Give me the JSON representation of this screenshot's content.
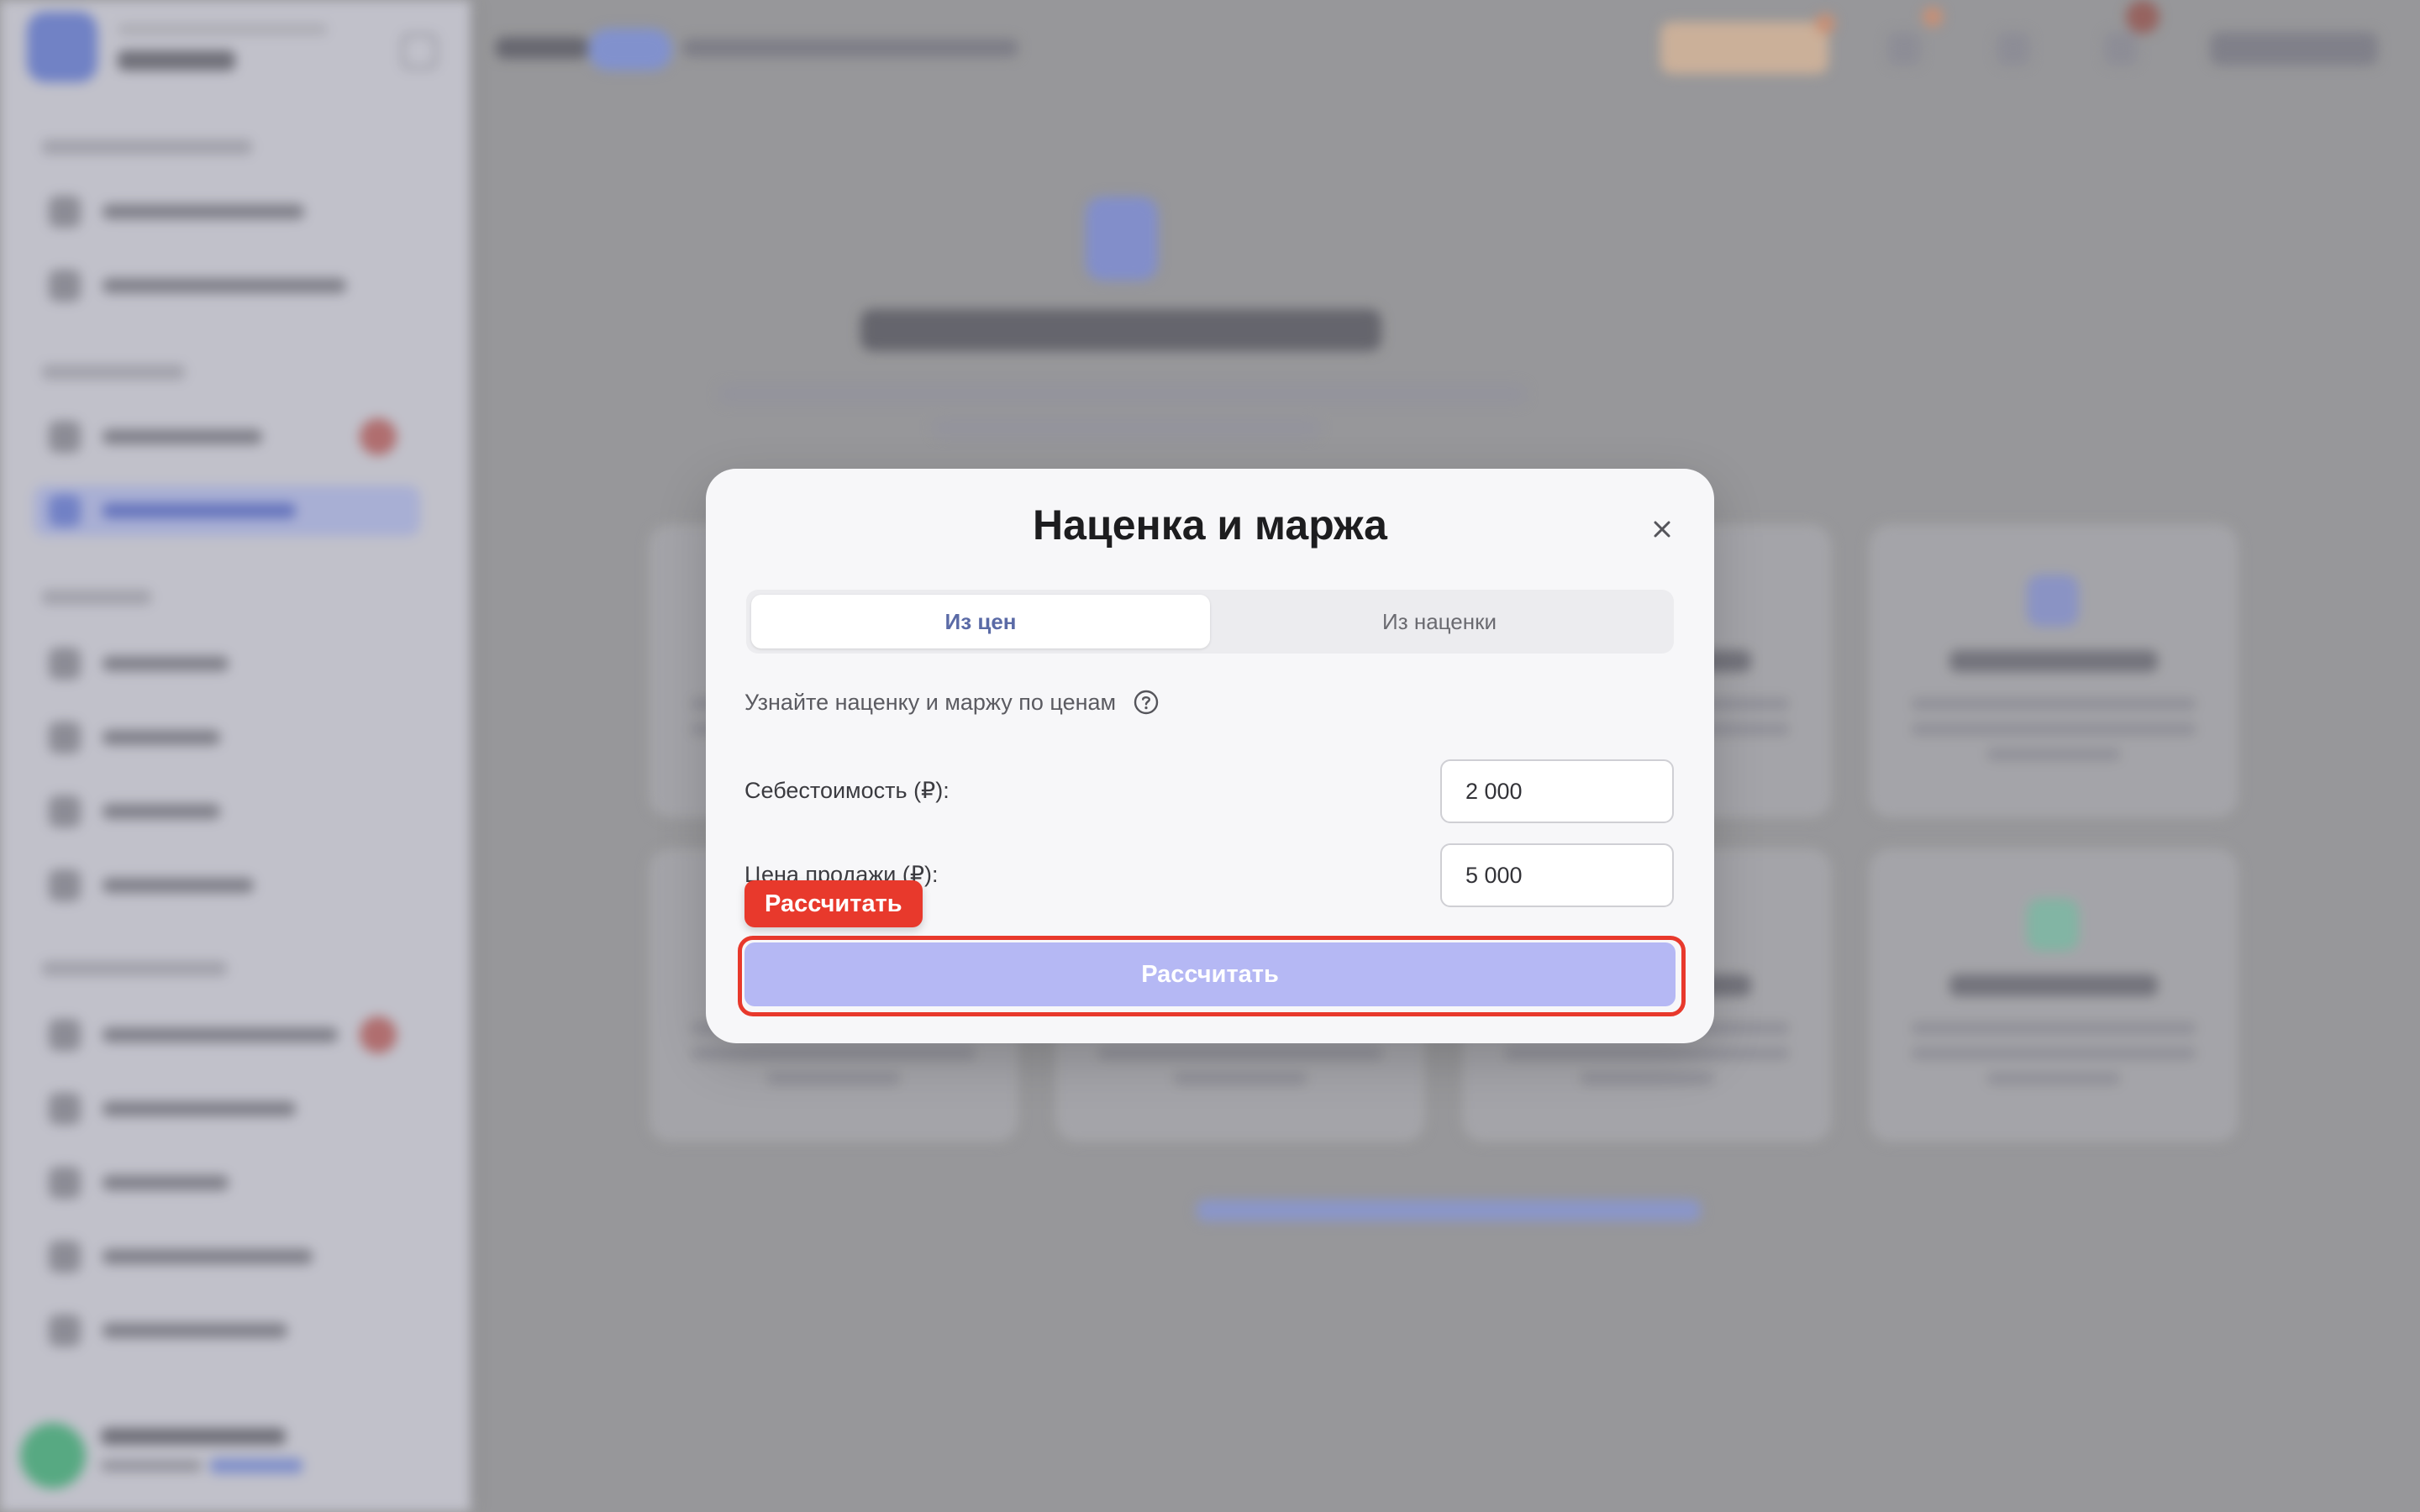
{
  "modal": {
    "title": "Наценка и маржа",
    "tabs": [
      {
        "label": "Из цен",
        "active": true
      },
      {
        "label": "Из наценки",
        "active": false
      }
    ],
    "hint": "Узнайте наценку и маржу по ценам",
    "fields": {
      "cost": {
        "label": "Себестоимость (₽):",
        "value": "2 000"
      },
      "price": {
        "label": "Цена продажи (₽):",
        "value": "5 000"
      }
    },
    "calculate_button": "Рассчитать",
    "icons": {
      "close": "close-icon",
      "help": "help-circle-icon"
    }
  },
  "annotation": {
    "label": "Рассчитать",
    "color": "#e8392c"
  },
  "colors": {
    "accent": "#b5b8f4",
    "active_tab_text": "#5a6aa6",
    "highlight": "#e8392c"
  }
}
